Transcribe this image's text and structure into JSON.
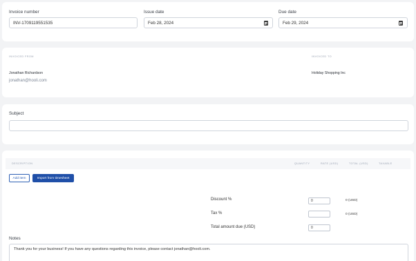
{
  "invoice_details": {
    "invoice_number_label": "Invoice number",
    "invoice_number_value": "INV-1709119551535",
    "issue_date_label": "Issue date",
    "issue_date_value": "Feb 28, 2024",
    "due_date_label": "Due date",
    "due_date_value": "Feb 29, 2024"
  },
  "parties": {
    "from_header": "INVOICED FROM",
    "to_header": "INVOICED TO",
    "from_name": "Jonathan Richardson",
    "from_email": "jonathan@hooli.com",
    "to_name": "Holiday Shopping Inc"
  },
  "subject": {
    "label": "Subject",
    "value": ""
  },
  "items": {
    "columns": [
      "DESCRIPTION",
      "QUANTITY",
      "RATE (USD)",
      "TOTAL (USD)",
      "TAXABLE"
    ],
    "add_item_label": "Add item",
    "import_label": "Import from timesheet"
  },
  "totals": {
    "discount_label": "Discount %",
    "discount_value": "0",
    "discount_amount": "0 (USD)",
    "tax_label": "Tax %",
    "tax_value": "",
    "tax_amount": "0 (USD)",
    "total_label": "Total amount due (USD)",
    "total_value": "0"
  },
  "notes": {
    "label": "Notes",
    "value": "Thank you for your business! If you have any questions regarding this invoice, please contact jonathan@hooli.com."
  },
  "colors": {
    "primary": "#1f4fa8",
    "background": "#f2f3f5",
    "muted": "#9aa3b2"
  }
}
